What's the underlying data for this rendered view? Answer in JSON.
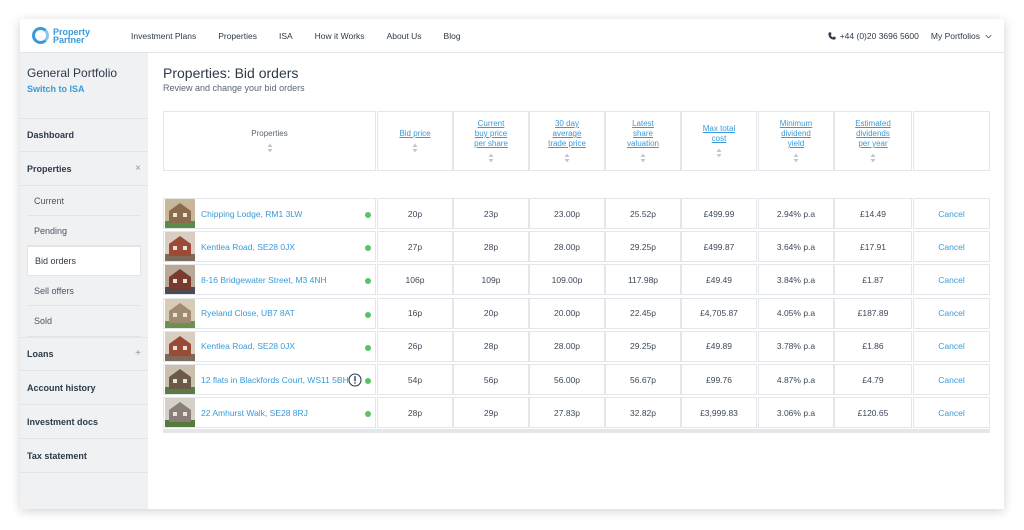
{
  "header": {
    "logo_line1": "Property",
    "logo_line2": "Partner",
    "nav": [
      "Investment Plans",
      "Properties",
      "ISA",
      "How it Works",
      "About Us",
      "Blog"
    ],
    "phone": "+44 (0)20 3696 5600",
    "portfolios": "My Portfolios"
  },
  "sidebar": {
    "title": "General Portfolio",
    "switch": "Switch to ISA",
    "dashboard": "Dashboard",
    "properties": "Properties",
    "properties_sub": [
      "Current",
      "Pending",
      "Bid orders",
      "Sell offers",
      "Sold"
    ],
    "loans": "Loans",
    "account_history": "Account history",
    "investment_docs": "Investment docs",
    "tax_statement": "Tax statement"
  },
  "page": {
    "title": "Properties: Bid orders",
    "subtitle": "Review and change your bid orders"
  },
  "table": {
    "headers": [
      "Properties",
      "Bid price",
      "Current\nbuy price\nper share",
      "30 day\naverage\ntrade price",
      "Latest\nshare\nvaluation",
      "Max total\ncost",
      "Minimum\ndividend\nyield",
      "Estimated\ndividends\nper year"
    ],
    "rows": [
      {
        "name": "Chipping Lodge, RM1 3LW",
        "bid": "20p",
        "buy": "23p",
        "avg": "23.00p",
        "val": "25.52p",
        "cost": "£499.99",
        "yield": "2.94% p.a",
        "div": "£14.49",
        "action": "Cancel",
        "warn": false
      },
      {
        "name": "Kentlea Road, SE28 0JX",
        "bid": "27p",
        "buy": "28p",
        "avg": "28.00p",
        "val": "29.25p",
        "cost": "£499.87",
        "yield": "3.64% p.a",
        "div": "£17.91",
        "action": "Cancel",
        "warn": false
      },
      {
        "name": "8-16 Bridgewater Street, M3 4NH",
        "bid": "106p",
        "buy": "109p",
        "avg": "109.00p",
        "val": "117.98p",
        "cost": "£49.49",
        "yield": "3.84% p.a",
        "div": "£1.87",
        "action": "Cancel",
        "warn": false
      },
      {
        "name": "Ryeland Close, UB7 8AT",
        "bid": "16p",
        "buy": "20p",
        "avg": "20.00p",
        "val": "22.45p",
        "cost": "£4,705.87",
        "yield": "4.05% p.a",
        "div": "£187.89",
        "action": "Cancel",
        "warn": false
      },
      {
        "name": "Kentlea Road, SE28 0JX",
        "bid": "26p",
        "buy": "28p",
        "avg": "28.00p",
        "val": "29.25p",
        "cost": "£49.89",
        "yield": "3.78% p.a",
        "div": "£1.86",
        "action": "Cancel",
        "warn": false
      },
      {
        "name": "12 flats in Blackfords Court, WS11 5BH",
        "bid": "54p",
        "buy": "56p",
        "avg": "56.00p",
        "val": "56.67p",
        "cost": "£99.76",
        "yield": "4.87% p.a",
        "div": "£4.79",
        "action": "Cancel",
        "warn": true
      },
      {
        "name": "22 Amhurst Walk, SE28 8RJ",
        "bid": "28p",
        "buy": "29p",
        "avg": "27.83p",
        "val": "32.82p",
        "cost": "£3,999.83",
        "yield": "3.06% p.a",
        "div": "£120.65",
        "action": "Cancel",
        "warn": false
      }
    ]
  },
  "colors": {
    "accent": "#3a9ad9",
    "status_dot": "#58c363",
    "sidebar_bg": "#f0f1f2"
  }
}
